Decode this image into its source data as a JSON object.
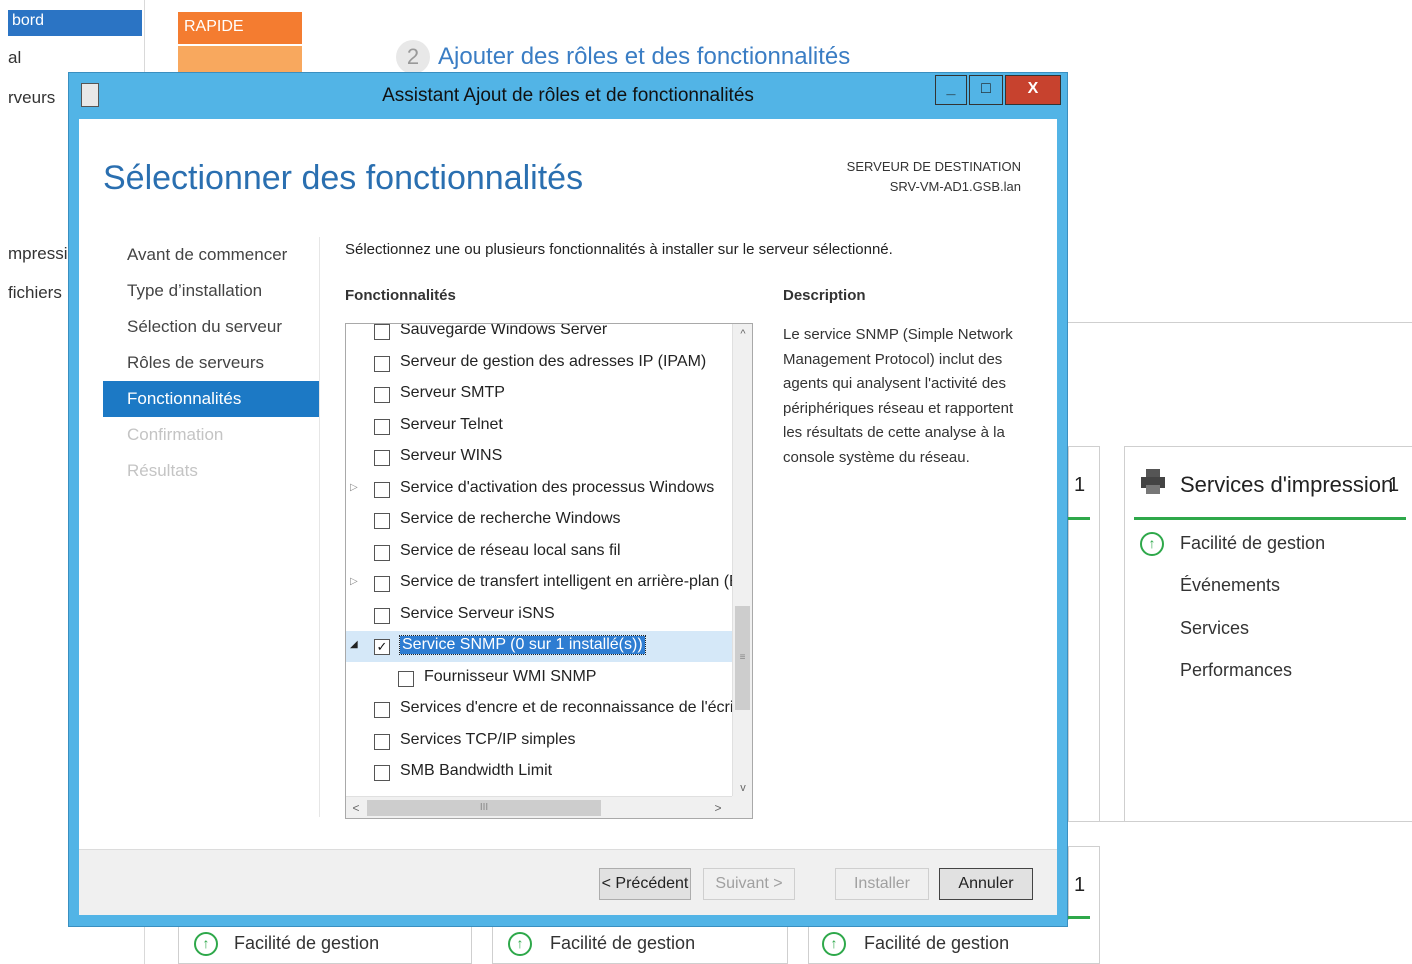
{
  "background": {
    "sidebar": {
      "selected": "bord",
      "items": [
        "al",
        "rveurs",
        "mpressi",
        "fichiers"
      ]
    },
    "rapide_label": "RAPIDE",
    "step_number": "2",
    "step_text": "Ajouter des rôles et des fonctionnalités",
    "tile_print": {
      "title": "Services d'impression",
      "count": "1",
      "links": [
        "Facilité de gestion",
        "Événements",
        "Services",
        "Performances"
      ]
    },
    "tile_left_count": "1",
    "tile_left_count2": "1",
    "bottom_links": [
      "Facilité de gestion",
      "Facilité de gestion",
      "Facilité de gestion"
    ]
  },
  "dialog": {
    "title": "Assistant Ajout de rôles et de fonctionnalités",
    "window_buttons": {
      "minimize": "_",
      "maximize": "□",
      "close": "X"
    },
    "page_title": "Sélectionner des fonctionnalités",
    "dest_label": "SERVEUR DE DESTINATION",
    "dest_server": "SRV-VM-AD1.GSB.lan",
    "nav": [
      {
        "label": "Avant de commencer",
        "state": "normal"
      },
      {
        "label": "Type d’installation",
        "state": "normal"
      },
      {
        "label": "Sélection du serveur",
        "state": "normal"
      },
      {
        "label": "Rôles de serveurs",
        "state": "normal"
      },
      {
        "label": "Fonctionnalités",
        "state": "active"
      },
      {
        "label": "Confirmation",
        "state": "disabled"
      },
      {
        "label": "Résultats",
        "state": "disabled"
      }
    ],
    "intro": "Sélectionnez une ou plusieurs fonctionnalités à installer sur le serveur sélectionné.",
    "features_header": "Fonctionnalités",
    "description_header": "Description",
    "features": [
      {
        "label": "Sauvegarde Windows Server",
        "checked": false,
        "expander": ""
      },
      {
        "label": "Serveur de gestion des adresses IP (IPAM)",
        "checked": false,
        "expander": ""
      },
      {
        "label": "Serveur SMTP",
        "checked": false,
        "expander": ""
      },
      {
        "label": "Serveur Telnet",
        "checked": false,
        "expander": ""
      },
      {
        "label": "Serveur WINS",
        "checked": false,
        "expander": ""
      },
      {
        "label": "Service d'activation des processus Windows",
        "checked": false,
        "expander": "▷"
      },
      {
        "label": "Service de recherche Windows",
        "checked": false,
        "expander": ""
      },
      {
        "label": "Service de réseau local sans fil",
        "checked": false,
        "expander": ""
      },
      {
        "label": "Service de transfert intelligent en arrière-plan (BIT",
        "checked": false,
        "expander": "▷"
      },
      {
        "label": "Service Serveur iSNS",
        "checked": false,
        "expander": ""
      },
      {
        "label": "Service SNMP (0 sur 1 installé(s))",
        "checked": true,
        "expander": "◢",
        "selected": true
      },
      {
        "label": "Fournisseur WMI SNMP",
        "checked": false,
        "expander": "",
        "child": true
      },
      {
        "label": "Services d'encre et de reconnaissance de l'écriture",
        "checked": false,
        "expander": ""
      },
      {
        "label": "Services TCP/IP simples",
        "checked": false,
        "expander": ""
      },
      {
        "label": "SMB Bandwidth Limit",
        "checked": false,
        "expander": ""
      }
    ],
    "scroll": {
      "up": "^",
      "down": "v",
      "left": "<",
      "right": ">",
      "grip_v": "≡",
      "grip_h": "III"
    },
    "description": "Le service SNMP (Simple Network Management Protocol) inclut des agents qui analysent l'activité des périphériques réseau et rapportent les résultats de cette analyse à la console système du réseau.",
    "buttons": {
      "previous": "< Précédent",
      "next": "Suivant >",
      "install": "Installer",
      "cancel": "Annuler"
    }
  },
  "colors": {
    "dialog_frame": "#52b4e6",
    "nav_active": "#1c79c5",
    "title_blue": "#2a6fb0",
    "close_button": "#c7422e",
    "status_green": "#2ea84a",
    "rapide_orange": "#f47c30"
  }
}
